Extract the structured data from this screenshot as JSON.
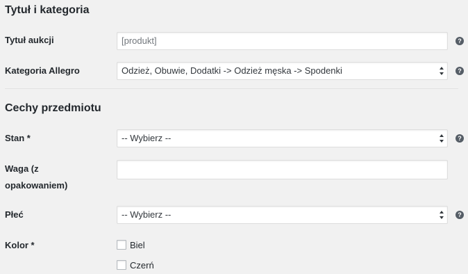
{
  "sections": {
    "title_category": "Tytuł i kategoria",
    "item_features": "Cechy przedmiotu"
  },
  "fields": {
    "auction_title": {
      "label": "Tytuł aukcji",
      "value": "[produkt]",
      "help_icon": "question-icon"
    },
    "category": {
      "label": "Kategoria Allegro",
      "value": "Odzież, Obuwie, Dodatki -> Odzież męska -> Spodenki",
      "help_icon": "question-icon"
    },
    "condition": {
      "label": "Stan *",
      "value": "-- Wybierz --",
      "help_icon": "question-icon"
    },
    "weight": {
      "label_line1": "Waga (z",
      "label_line2": "opakowaniem)",
      "value": ""
    },
    "gender": {
      "label": "Płeć",
      "value": "-- Wybierz --",
      "help_icon": "question-icon"
    },
    "color": {
      "label": "Kolor *",
      "options": [
        "Biel",
        "Czerń"
      ]
    }
  },
  "colors": {
    "background": "#f1f1f1",
    "text": "#23282d",
    "help_icon": "#555d66"
  }
}
